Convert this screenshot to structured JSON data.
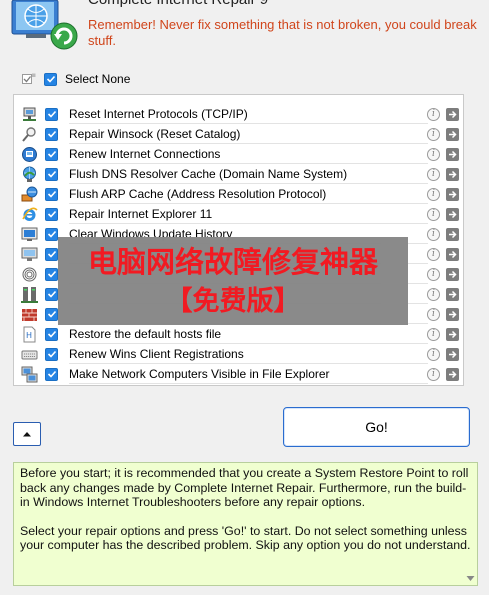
{
  "app": {
    "title": "Complete Internet Repair 9",
    "warning": "Remember! Never fix something that is not broken, you could break stuff."
  },
  "select_toggle": {
    "label": "Select None"
  },
  "options": [
    {
      "label": "Reset Internet Protocols (TCP/IP)",
      "icon": "network-adapter-icon",
      "checked": true
    },
    {
      "label": "Repair Winsock (Reset Catalog)",
      "icon": "magnifier-icon",
      "checked": true
    },
    {
      "label": "Renew Internet Connections",
      "icon": "network-globe-icon",
      "checked": true
    },
    {
      "label": "Flush DNS Resolver Cache (Domain Name System)",
      "icon": "globe-icon",
      "checked": true
    },
    {
      "label": "Flush ARP Cache (Address Resolution Protocol)",
      "icon": "network-sharing-icon",
      "checked": true
    },
    {
      "label": "Repair Internet Explorer 11",
      "icon": "internet-explorer-icon",
      "checked": true
    },
    {
      "label": "Clear Windows Update History",
      "icon": "windows-update-icon",
      "checked": true
    },
    {
      "label": "",
      "icon": "monitor-icon",
      "checked": true
    },
    {
      "label": "",
      "icon": "fingerprint-icon",
      "checked": true
    },
    {
      "label": "",
      "icon": "server-icon",
      "checked": true
    },
    {
      "label": "",
      "icon": "firewall-icon",
      "checked": true
    },
    {
      "label": "Restore the default hosts file",
      "icon": "hosts-file-icon",
      "checked": true
    },
    {
      "label": "Renew Wins Client Registrations",
      "icon": "keyboard-icon",
      "checked": true
    },
    {
      "label": "Make Network Computers Visible in File Explorer",
      "icon": "network-computers-icon",
      "checked": true
    }
  ],
  "overlay_banner": {
    "line1": "电脑网络故障修复神器",
    "line2": "【免费版】"
  },
  "actions": {
    "go_label": "Go!"
  },
  "help": {
    "paragraph1": "Before you start; it is recommended that you create a System Restore Point to roll back any changes made by Complete Internet Repair. Furthermore, run the build-in Windows Internet Troubleshooters before any repair options.",
    "paragraph2": "Select your repair options and press 'Go!' to start. Do not select something unless your computer has the described problem. Skip any option you do not understand."
  },
  "colors": {
    "warning": "#d0451b",
    "checkbox": "#2584e4",
    "banner_text": "#f2161e",
    "help_background": "#f0ffd0"
  }
}
